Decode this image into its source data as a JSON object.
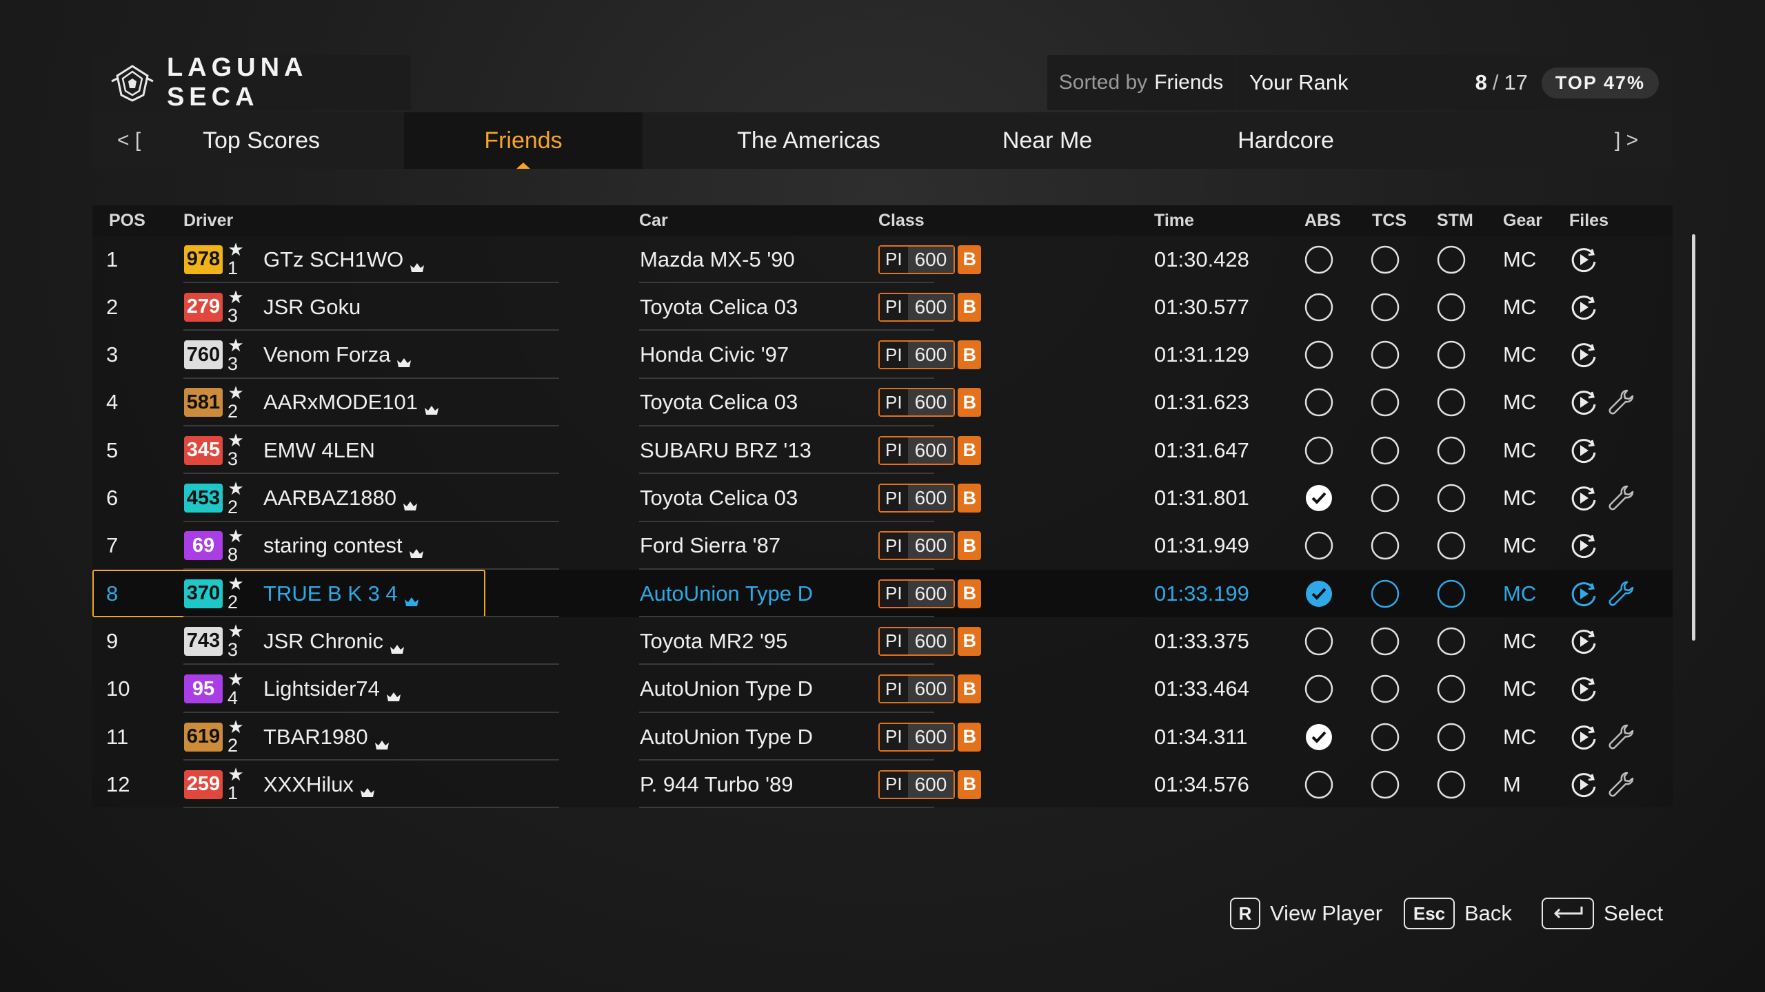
{
  "header": {
    "track_name": "LAGUNA SECA",
    "sorted_prefix": "Sorted by",
    "sorted_value": "Friends",
    "rank_label": "Your Rank",
    "rank_value": "8",
    "rank_separator": "/",
    "rank_total": "17",
    "top_percent": "TOP 47%"
  },
  "tabs": {
    "nav_left": "< [",
    "nav_right": "] >",
    "items": [
      {
        "label": "Top Scores",
        "active": false
      },
      {
        "label": "Friends",
        "active": true
      },
      {
        "label": "The Americas",
        "active": false
      },
      {
        "label": "Near Me",
        "active": false
      },
      {
        "label": "Hardcore",
        "active": false
      }
    ]
  },
  "columns": {
    "pos": "POS",
    "driver": "Driver",
    "car": "Car",
    "class": "Class",
    "time": "Time",
    "abs": "ABS",
    "tcs": "TCS",
    "stm": "STM",
    "gear": "Gear",
    "files": "Files"
  },
  "pi_label": "PI",
  "rating_colors": {
    "yellow": "#f0b418",
    "red": "#e0483d",
    "white": "#dedede",
    "bronze": "#cc8c3c",
    "cyan": "#1fc8c8",
    "purple": "#a93de6",
    "orange_class": "#e4711c",
    "highlight_blue": "#2ea8e6",
    "selection_gold": "#f0a62a"
  },
  "rows": [
    {
      "pos": "1",
      "rating": "978",
      "rating_color": "yellow",
      "stars": "1",
      "driver": "GTz SCH1WO",
      "crown": true,
      "car": "Mazda MX-5 '90",
      "pi": "600",
      "class": "B",
      "time": "01:30.428",
      "abs": false,
      "tcs": false,
      "stm": false,
      "gear": "MC",
      "tune": false,
      "mine": false
    },
    {
      "pos": "2",
      "rating": "279",
      "rating_color": "red",
      "stars": "3",
      "driver": "JSR Goku",
      "crown": false,
      "car": "Toyota Celica 03",
      "pi": "600",
      "class": "B",
      "time": "01:30.577",
      "abs": false,
      "tcs": false,
      "stm": false,
      "gear": "MC",
      "tune": false,
      "mine": false
    },
    {
      "pos": "3",
      "rating": "760",
      "rating_color": "white",
      "stars": "3",
      "driver": "Venom Forza",
      "crown": true,
      "car": "Honda Civic '97",
      "pi": "600",
      "class": "B",
      "time": "01:31.129",
      "abs": false,
      "tcs": false,
      "stm": false,
      "gear": "MC",
      "tune": false,
      "mine": false
    },
    {
      "pos": "4",
      "rating": "581",
      "rating_color": "bronze",
      "stars": "2",
      "driver": "AARxMODE101",
      "crown": true,
      "car": "Toyota Celica 03",
      "pi": "600",
      "class": "B",
      "time": "01:31.623",
      "abs": false,
      "tcs": false,
      "stm": false,
      "gear": "MC",
      "tune": true,
      "mine": false
    },
    {
      "pos": "5",
      "rating": "345",
      "rating_color": "red",
      "stars": "3",
      "driver": "EMW 4LEN",
      "crown": false,
      "car": "SUBARU BRZ '13",
      "pi": "600",
      "class": "B",
      "time": "01:31.647",
      "abs": false,
      "tcs": false,
      "stm": false,
      "gear": "MC",
      "tune": false,
      "mine": false
    },
    {
      "pos": "6",
      "rating": "453",
      "rating_color": "cyan",
      "stars": "2",
      "driver": "AARBAZ1880",
      "crown": true,
      "car": "Toyota Celica 03",
      "pi": "600",
      "class": "B",
      "time": "01:31.801",
      "abs": true,
      "tcs": false,
      "stm": false,
      "gear": "MC",
      "tune": true,
      "mine": false
    },
    {
      "pos": "7",
      "rating": "69",
      "rating_color": "purple",
      "stars": "8",
      "driver": "staring contest",
      "crown": true,
      "car": "Ford Sierra '87",
      "pi": "600",
      "class": "B",
      "time": "01:31.949",
      "abs": false,
      "tcs": false,
      "stm": false,
      "gear": "MC",
      "tune": false,
      "mine": false
    },
    {
      "pos": "8",
      "rating": "370",
      "rating_color": "cyan",
      "stars": "2",
      "driver": "TRUE B K 3 4",
      "crown": true,
      "car": "AutoUnion Type D",
      "pi": "600",
      "class": "B",
      "time": "01:33.199",
      "abs": true,
      "tcs": false,
      "stm": false,
      "gear": "MC",
      "tune": true,
      "mine": true
    },
    {
      "pos": "9",
      "rating": "743",
      "rating_color": "white",
      "stars": "3",
      "driver": "JSR Chronic",
      "crown": true,
      "car": "Toyota MR2 '95",
      "pi": "600",
      "class": "B",
      "time": "01:33.375",
      "abs": false,
      "tcs": false,
      "stm": false,
      "gear": "MC",
      "tune": false,
      "mine": false
    },
    {
      "pos": "10",
      "rating": "95",
      "rating_color": "purple",
      "stars": "4",
      "driver": "Lightsider74",
      "crown": true,
      "car": "AutoUnion Type D",
      "pi": "600",
      "class": "B",
      "time": "01:33.464",
      "abs": false,
      "tcs": false,
      "stm": false,
      "gear": "MC",
      "tune": false,
      "mine": false
    },
    {
      "pos": "11",
      "rating": "619",
      "rating_color": "bronze",
      "stars": "2",
      "driver": "TBAR1980",
      "crown": true,
      "car": "AutoUnion Type D",
      "pi": "600",
      "class": "B",
      "time": "01:34.311",
      "abs": true,
      "tcs": false,
      "stm": false,
      "gear": "MC",
      "tune": true,
      "mine": false
    },
    {
      "pos": "12",
      "rating": "259",
      "rating_color": "red",
      "stars": "1",
      "driver": "XXXHilux",
      "crown": true,
      "car": "P. 944 Turbo '89",
      "pi": "600",
      "class": "B",
      "time": "01:34.576",
      "abs": false,
      "tcs": false,
      "stm": false,
      "gear": "M",
      "tune": true,
      "mine": false
    }
  ],
  "footer": {
    "view_key": "R",
    "view_label": "View Player",
    "back_key": "Esc",
    "back_label": "Back",
    "select_label": "Select"
  }
}
